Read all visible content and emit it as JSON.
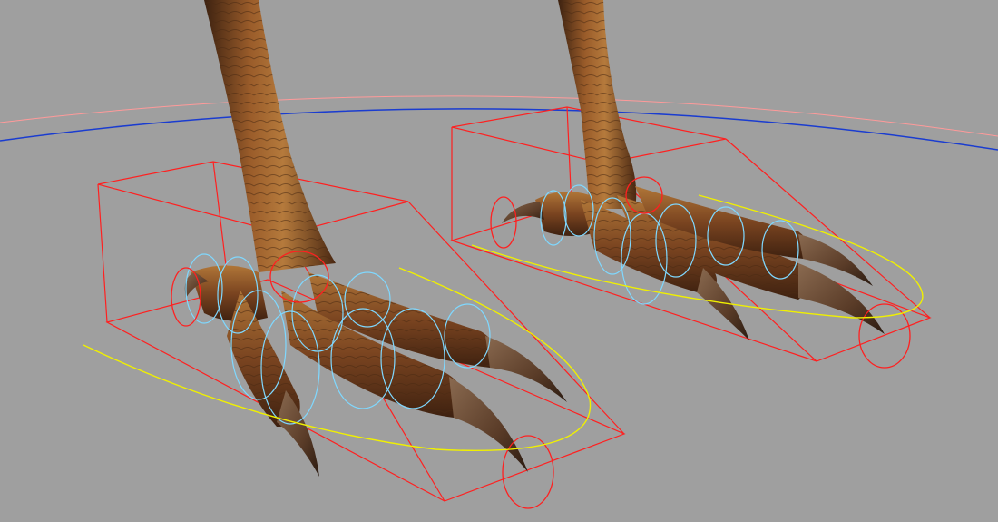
{
  "viewport": {
    "background": "#9f9f9f",
    "description_colors": {
      "skin_dark": "#4a2a14",
      "skin_mid": "#8a5226",
      "skin_light": "#b9803f",
      "claw": "#6b4a33",
      "claw_tip": "#2f1f14",
      "control_box": "#ff2020",
      "control_circle": "#ff2020",
      "control_ring": "#7fd8ff",
      "ik_curve": "#f0f000",
      "grid_far": "#ff9a9a",
      "grid_near": "#1a3cd0"
    }
  },
  "controls": {
    "left_foot_box": "foot-control-box-left",
    "right_foot_box": "foot-control-box-right"
  }
}
